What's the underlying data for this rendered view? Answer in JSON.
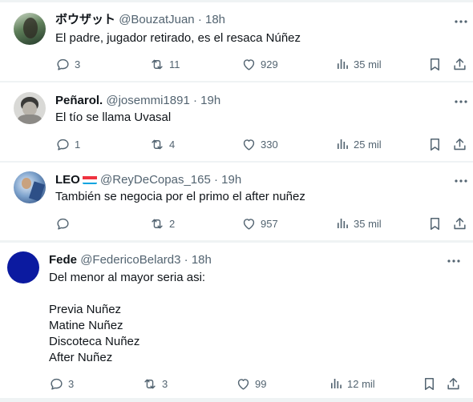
{
  "tweets": [
    {
      "display_name": "ボウザット",
      "handle": "@BouzatJuan",
      "time": "· 18h",
      "text": "El padre, jugador retirado, es el resaca Núñez",
      "replies": "3",
      "retweets": "11",
      "likes": "929",
      "views": "35 mil"
    },
    {
      "display_name": "Peñarol.",
      "handle": "@josemmi1891",
      "time": "· 19h",
      "text": "El tío se llama Uvasal",
      "replies": "1",
      "retweets": "4",
      "likes": "330",
      "views": "25 mil"
    },
    {
      "display_name": "LEO",
      "handle": "@ReyDeCopas_165",
      "time": "· 19h",
      "text": "También se negocia por el primo el after nuñez",
      "replies": "",
      "retweets": "2",
      "likes": "957",
      "views": "35 mil"
    },
    {
      "display_name": "Fede",
      "handle": "@FedericoBelard3",
      "time": "· 18h",
      "text": "Del menor al mayor seria asi:\n\nPrevia Nuñez\nMatine Nuñez\nDiscoteca Nuñez\nAfter Nuñez",
      "replies": "3",
      "retweets": "3",
      "likes": "99",
      "views": "12 mil"
    }
  ],
  "icons": {
    "more": "more-horizontal-icon",
    "reply": "reply-icon",
    "retweet": "retweet-icon",
    "like": "heart-icon",
    "views": "views-bar-chart-icon",
    "bookmark": "bookmark-icon",
    "share": "share-icon",
    "flag": "luxembourg-flag-icon"
  },
  "colors": {
    "text": "#0f1419",
    "secondary": "#536471",
    "separator": "#eff3f4",
    "fede_avatar": "#0b1aa0"
  }
}
